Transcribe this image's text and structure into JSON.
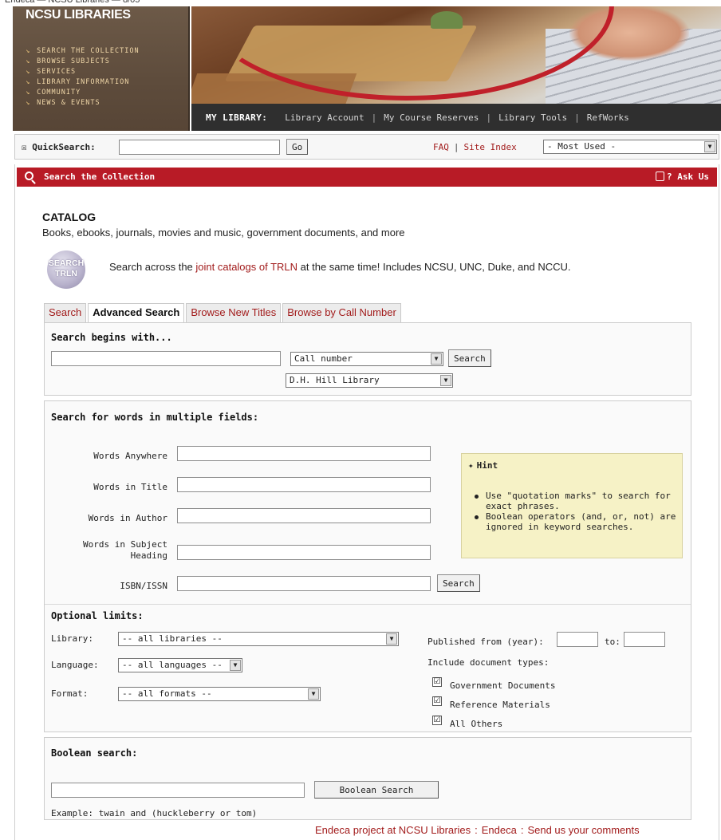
{
  "page_caption": "Endeca — NCSU Libraries — 8/05",
  "brand": {
    "title": "NCSU LIBRARIES",
    "nav": [
      {
        "label": "Search the Collection"
      },
      {
        "label": "Browse Subjects"
      },
      {
        "label": "Services"
      },
      {
        "label": "Library Information"
      },
      {
        "label": "Community"
      },
      {
        "label": "News & Events"
      }
    ]
  },
  "mylibrary": {
    "label": "MY LIBRARY:",
    "links": [
      "Library Account",
      "My Course Reserves",
      "Library Tools",
      "RefWorks"
    ],
    "separator": "|"
  },
  "quicksearch": {
    "checkbox_glyph": "☒",
    "label": "QuickSearch:",
    "go_label": "Go",
    "faq_label": "FAQ",
    "separator": "|",
    "site_index_label": "Site Index",
    "most_used_value": "- Most Used -"
  },
  "section_bar": {
    "title": "Search the Collection",
    "ask_label": "? Ask Us",
    "colors": {
      "bar": "#b81b26",
      "link": "#a21c1c",
      "hint_bg": "#f6f2c6"
    }
  },
  "catalog": {
    "title": "CATALOG",
    "subtitle": "Books, ebooks, journals, movies and music, government documents, and more",
    "trln_logo_line1": "SEARCH",
    "trln_logo_line2": "TRLN",
    "trln_text_before": "Search across the ",
    "trln_link": "joint catalogs of TRLN",
    "trln_text_after": " at the same time! Includes NCSU, UNC, Duke, and NCCU."
  },
  "tabs": [
    {
      "label": "Search",
      "active": false
    },
    {
      "label": "Advanced Search",
      "active": true
    },
    {
      "label": "Browse New Titles",
      "active": false
    },
    {
      "label": "Browse by Call Number",
      "active": false
    }
  ],
  "begins_with": {
    "heading": "Search begins with...",
    "type_value": "Call number",
    "library_value": "D.H. Hill Library",
    "search_label": "Search"
  },
  "multi_fields": {
    "heading": "Search for words in multiple fields:",
    "fields": [
      {
        "label": "Words Anywhere"
      },
      {
        "label": "Words in Title"
      },
      {
        "label": "Words in Author"
      },
      {
        "label_line1": "Words in Subject",
        "label_line2": "Heading"
      },
      {
        "label": "ISBN/ISSN"
      }
    ],
    "search_label": "Search",
    "hint": {
      "title": "Hint",
      "items": [
        "Use \"quotation marks\" to search for exact phrases.",
        "Boolean operators (and, or, not) are ignored in keyword searches."
      ]
    }
  },
  "limits": {
    "heading": "Optional limits:",
    "library_label": "Library:",
    "library_value": "-- all libraries --",
    "language_label": "Language:",
    "language_value": "-- all languages --",
    "format_label": "Format:",
    "format_value": "-- all formats --",
    "published_label": "Published from (year):",
    "to_label": "to:",
    "doc_types_label": "Include document types:",
    "doc_types": [
      {
        "label": "Government Documents",
        "checked": "☑"
      },
      {
        "label": "Reference Materials",
        "checked": "☑"
      },
      {
        "label": "All Others",
        "checked": "☑"
      }
    ]
  },
  "boolean": {
    "heading": "Boolean search:",
    "button_label": "Boolean Search",
    "example": "Example: twain and (huckleberry or tom)"
  },
  "footer": {
    "project_label": "Endeca project at NCSU Libraries",
    "endeca_label": "Endeca",
    "comments_label": "Send us your comments",
    "separator": ":"
  }
}
